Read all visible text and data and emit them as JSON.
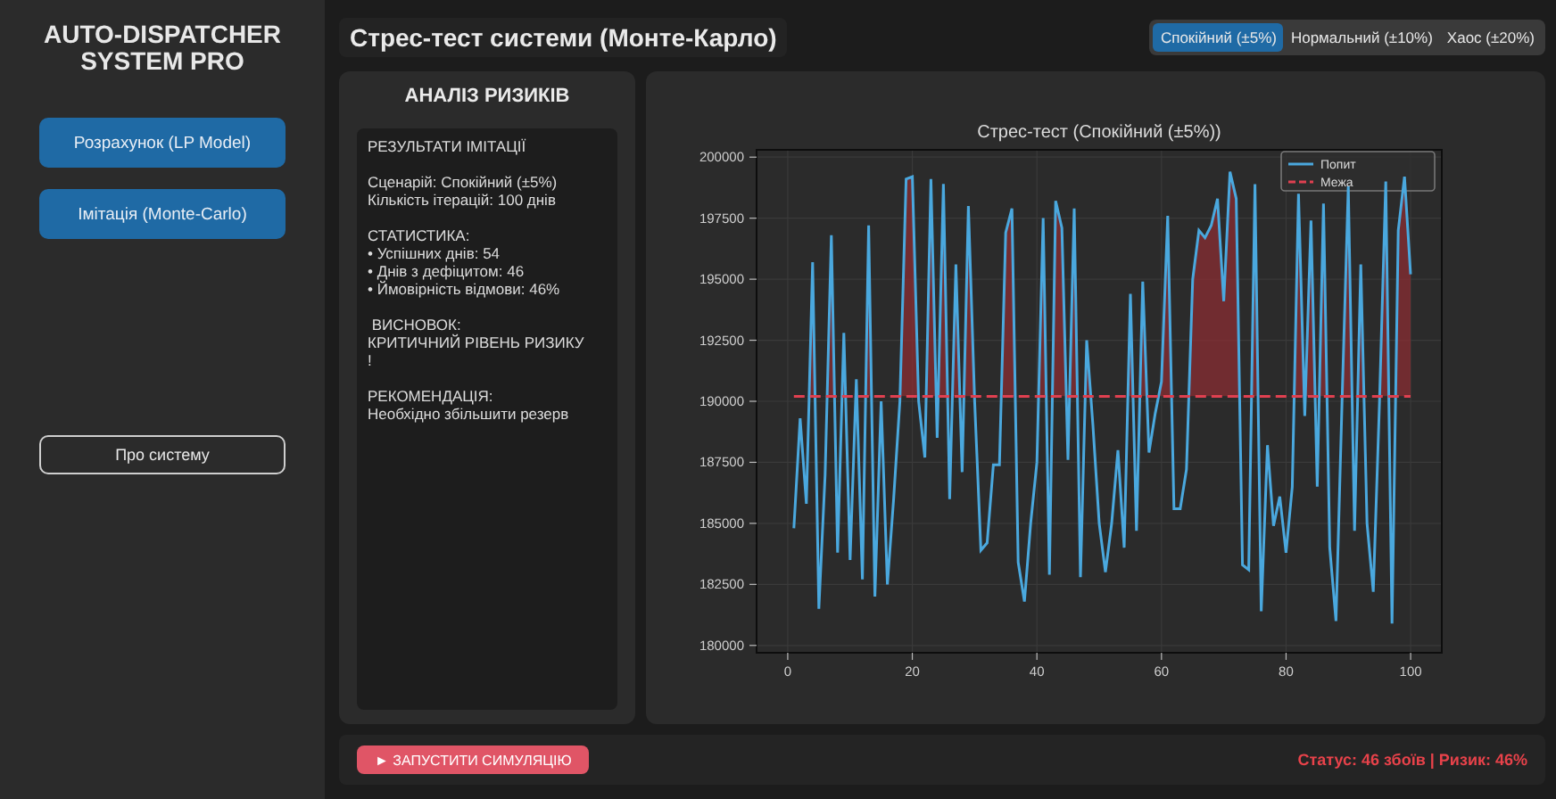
{
  "sidebar": {
    "title": "AUTO-DISPATCHER SYSTEM PRO",
    "nav": [
      {
        "label": "Розрахунок (LP Model)",
        "selected": false
      },
      {
        "label": "Імітація (Monte-Carlo)",
        "selected": false
      }
    ],
    "about_button": "Про систему"
  },
  "header": {
    "title": "Стрес-тест системи (Монте-Карло)",
    "scenarios": [
      {
        "label": "Спокійний (±5%)",
        "selected": true
      },
      {
        "label": "Нормальний (±10%)",
        "selected": false
      },
      {
        "label": "Хаос (±20%)",
        "selected": false
      }
    ]
  },
  "analysis": {
    "title": "АНАЛІЗ РИЗИКІВ",
    "report": "РЕЗУЛЬТАТИ ІМІТАЦІЇ\n\nСценарій: Спокійний (±5%)\nКількість ітерацій: 100 днів\n\nСТАТИСТИКА:\n• Успішних днів: 54\n• Днів з дефіцитом: 46\n• Ймовірність відмови: 46%\n\n ВИСНОВОК:\nКРИТИЧНИЙ РІВЕНЬ РИЗИКУ\n!\n\nРЕКОМЕНДАЦІЯ:\nНеобхідно збільшити резерв"
  },
  "chart": {
    "chart_data": {
      "type": "line",
      "grid": true,
      "legend": true,
      "title": "Стрес-тест (Спокійний (±5%))",
      "xlim": [
        -5,
        105
      ],
      "ylim": [
        179700,
        200300
      ],
      "xticks": [
        0,
        20,
        40,
        60,
        80,
        100
      ],
      "yticks": [
        {
          "value": 180000,
          "label": "180000"
        },
        {
          "value": 182500,
          "label": "182500"
        },
        {
          "value": 185000,
          "label": "185000"
        },
        {
          "value": 187500,
          "label": "187500"
        },
        {
          "value": 190000,
          "label": "190000"
        },
        {
          "value": 192500,
          "label": "192500"
        },
        {
          "value": 195000,
          "label": "195000"
        },
        {
          "value": 197500,
          "label": "197500"
        },
        {
          "value": 200000,
          "label": "200000"
        }
      ],
      "x": [
        1,
        2,
        3,
        4,
        5,
        6,
        7,
        8,
        9,
        10,
        11,
        12,
        13,
        14,
        15,
        16,
        17,
        18,
        19,
        20,
        21,
        22,
        23,
        24,
        25,
        26,
        27,
        28,
        29,
        30,
        31,
        32,
        33,
        34,
        35,
        36,
        37,
        38,
        39,
        40,
        41,
        42,
        43,
        44,
        45,
        46,
        47,
        48,
        49,
        50,
        51,
        52,
        53,
        54,
        55,
        56,
        57,
        58,
        59,
        60,
        61,
        62,
        63,
        64,
        65,
        66,
        67,
        68,
        69,
        70,
        71,
        72,
        73,
        74,
        75,
        76,
        77,
        78,
        79,
        80,
        81,
        82,
        83,
        84,
        85,
        86,
        87,
        88,
        89,
        90,
        91,
        92,
        93,
        94,
        95,
        96,
        97,
        98,
        99,
        100
      ],
      "series": [
        {
          "name": "Попит",
          "color": "#4aa8de",
          "line_style": "solid",
          "values": [
            184800,
            189300,
            185800,
            195700,
            181500,
            187000,
            196800,
            183800,
            192800,
            183500,
            190900,
            182700,
            197200,
            182000,
            190000,
            182500,
            186000,
            190000,
            199100,
            199200,
            190000,
            187700,
            199100,
            188500,
            198900,
            186000,
            195600,
            187100,
            198000,
            190000,
            183900,
            184200,
            187400,
            187400,
            196900,
            197900,
            183400,
            181800,
            185000,
            187500,
            197500,
            182900,
            198200,
            197100,
            187600,
            197900,
            182800,
            192500,
            189000,
            185000,
            183000,
            185000,
            188000,
            184000,
            194400,
            184700,
            194900,
            187900,
            189500,
            190800,
            197600,
            185600,
            185600,
            187200,
            195000,
            197000,
            196700,
            197200,
            198300,
            194100,
            199400,
            198300,
            183300,
            183100,
            198900,
            181400,
            188200,
            184900,
            186100,
            183800,
            186500,
            198500,
            189400,
            197400,
            186500,
            198100,
            184000,
            181000,
            190000,
            198800,
            184700,
            195600,
            185000,
            182200,
            190000,
            199000,
            180900,
            197000,
            199200,
            195200
          ]
        },
        {
          "name": "Межа",
          "color": "#e04050",
          "line_style": "dashed",
          "values": [
            190200,
            190200,
            190200,
            190200,
            190200,
            190200,
            190200,
            190200,
            190200,
            190200,
            190200,
            190200,
            190200,
            190200,
            190200,
            190200,
            190200,
            190200,
            190200,
            190200,
            190200,
            190200,
            190200,
            190200,
            190200,
            190200,
            190200,
            190200,
            190200,
            190200,
            190200,
            190200,
            190200,
            190200,
            190200,
            190200,
            190200,
            190200,
            190200,
            190200,
            190200,
            190200,
            190200,
            190200,
            190200,
            190200,
            190200,
            190200,
            190200,
            190200,
            190200,
            190200,
            190200,
            190200,
            190200,
            190200,
            190200,
            190200,
            190200,
            190200,
            190200,
            190200,
            190200,
            190200,
            190200,
            190200,
            190200,
            190200,
            190200,
            190200,
            190200,
            190200,
            190200,
            190200,
            190200,
            190200,
            190200,
            190200,
            190200,
            190200,
            190200,
            190200,
            190200,
            190200,
            190200,
            190200,
            190200,
            190200,
            190200,
            190200,
            190200,
            190200,
            190200,
            190200,
            190200,
            190200,
            190200,
            190200,
            190200,
            190200
          ]
        }
      ]
    }
  },
  "footer": {
    "run_button": "► ЗАПУСТИТИ СИМУЛЯЦІЮ",
    "status": "Статус: 46 збоїв | Ризик: 46%"
  }
}
